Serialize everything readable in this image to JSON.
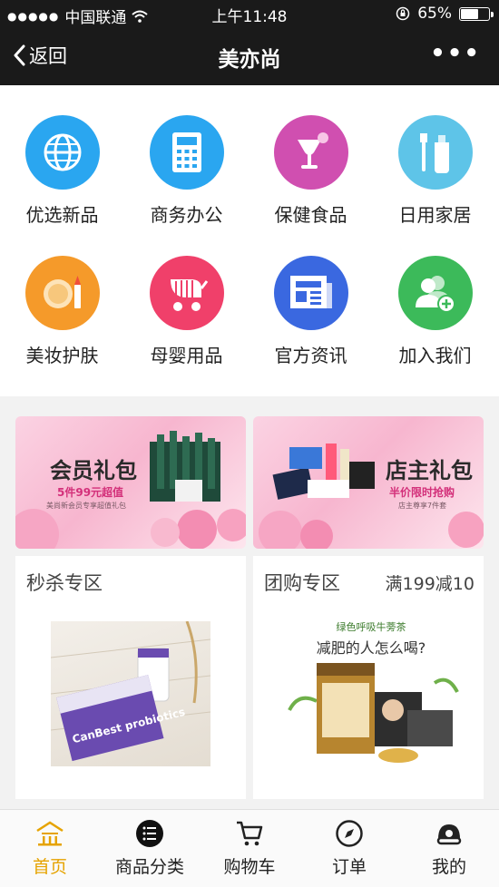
{
  "status": {
    "carrier": "中国联通",
    "time": "上午11:48",
    "battery": "65%",
    "battery_level": 0.65
  },
  "nav": {
    "back_label": "返回",
    "title": "美亦尚",
    "more": "•••"
  },
  "categories": [
    {
      "label": "优选新品",
      "icon": "globe-icon",
      "color": "#2aa6f0"
    },
    {
      "label": "商务办公",
      "icon": "calculator-icon",
      "color": "#2aa6f0"
    },
    {
      "label": "保健食品",
      "icon": "cocktail-glass-icon",
      "color": "#d04fb0"
    },
    {
      "label": "日用家居",
      "icon": "toothbrush-icon",
      "color": "#5ec4e8"
    },
    {
      "label": "美妆护肤",
      "icon": "compact-lipstick-icon",
      "color": "#f59a2a"
    },
    {
      "label": "母婴用品",
      "icon": "stroller-icon",
      "color": "#f0406a"
    },
    {
      "label": "官方资讯",
      "icon": "newspaper-icon",
      "color": "#3a68e0"
    },
    {
      "label": "加入我们",
      "icon": "add-user-icon",
      "color": "#3cba5a"
    }
  ],
  "promos": [
    {
      "title": "会员礼包",
      "subtitle": "5件99元超值",
      "tiny": "美尚新会员专享超值礼包"
    },
    {
      "title": "店主礼包",
      "subtitle": "半价限时抢购",
      "tiny": "店主尊享7件套"
    }
  ],
  "sections": {
    "flash": {
      "title": "秒杀专区",
      "image_text": "CanBest probiotics"
    },
    "group": {
      "title": "团购专区",
      "badge": "满199减10",
      "image_caption": "减肥的人怎么喝?",
      "image_brand": "绿色呼吸牛蒡茶"
    }
  },
  "tabs": [
    {
      "label": "首页",
      "icon": "home-icon",
      "active": true
    },
    {
      "label": "商品分类",
      "icon": "list-icon",
      "active": false
    },
    {
      "label": "购物车",
      "icon": "cart-icon",
      "active": false
    },
    {
      "label": "订单",
      "icon": "compass-icon",
      "active": false
    },
    {
      "label": "我的",
      "icon": "user-icon",
      "active": false
    }
  ],
  "colors": {
    "accent": "#e6a300",
    "bar": "#1a1a1a"
  }
}
